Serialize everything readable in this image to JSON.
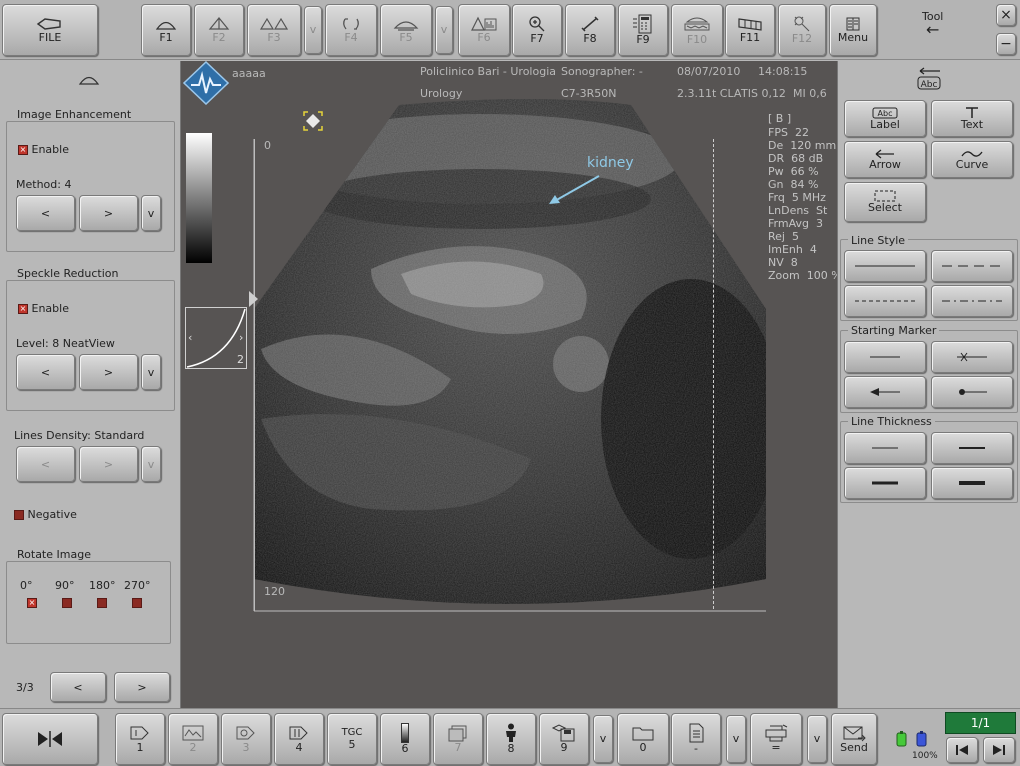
{
  "top_toolbar": {
    "file_label": "FILE",
    "keys": [
      {
        "label": "F1",
        "icon": "probe-icon"
      },
      {
        "label": "F2",
        "icon": "probe-icon"
      },
      {
        "label": "F3",
        "icon": "probe-pair-icon"
      },
      {
        "label": "v",
        "icon": ""
      },
      {
        "label": "F4",
        "icon": "rotate-icon"
      },
      {
        "label": "F5",
        "icon": "probe-icon"
      },
      {
        "label": "v",
        "icon": ""
      },
      {
        "label": "F6",
        "icon": "sector-icon"
      },
      {
        "label": "F7",
        "icon": "zoom-icon"
      },
      {
        "label": "F8",
        "icon": "measure-icon"
      },
      {
        "label": "F9",
        "icon": "calculator-icon"
      },
      {
        "label": "F10",
        "icon": "scan-icon"
      },
      {
        "label": "F11",
        "icon": "film-icon"
      },
      {
        "label": "F12",
        "icon": "spark-icon"
      },
      {
        "label": "Menu",
        "icon": "menu-icon"
      }
    ],
    "tool_label": "Tool",
    "tool_arrow": "←",
    "close_label": "×",
    "minimize_label": "−"
  },
  "left_panel": {
    "image_enhancement": {
      "title": "Image Enhancement",
      "enable_label": "Enable",
      "method_label": "Method: 4",
      "prev": "<",
      "next": ">",
      "dropdown": "v"
    },
    "speckle_reduction": {
      "title": "Speckle Reduction",
      "enable_label": "Enable",
      "level_label": "Level: 8 NeatView",
      "prev": "<",
      "next": ">",
      "dropdown": "v"
    },
    "lines_density": {
      "label": "Lines Density: Standard",
      "prev": "<",
      "next": ">",
      "dropdown": "v"
    },
    "negative_label": "Negative",
    "rotate_image": {
      "title": "Rotate Image",
      "options": [
        "0°",
        "90°",
        "180°",
        "270°"
      ]
    },
    "page_label": "3/3",
    "page_prev": "<",
    "page_next": ">"
  },
  "image_header": {
    "patient": "aaaaa",
    "hospital": "Policlinico Bari - Urologia",
    "sonographer": "Sonographer: -",
    "date": "08/07/2010",
    "time": "14:08:15",
    "department": "Urology",
    "probe": "C7-3R50N",
    "version": "2.3.11t CLA",
    "tis": "TIS 0,12",
    "mi": "MI 0,6"
  },
  "image_params": {
    "mode": "[ B ]",
    "rows": [
      [
        "FPS",
        "22"
      ],
      [
        "De",
        "120 mm"
      ],
      [
        "DR",
        "68 dB"
      ],
      [
        "Pw",
        "66 %"
      ],
      [
        "Gn",
        "84 %"
      ],
      [
        "Frq",
        "5 MHz"
      ],
      [
        "LnDens",
        "St"
      ],
      [
        "FrmAvg",
        "3"
      ],
      [
        "Rej",
        "5"
      ],
      [
        "ImEnh",
        "4"
      ],
      [
        "NV",
        "8"
      ],
      [
        "Zoom",
        "100 %"
      ]
    ]
  },
  "image": {
    "annotation": "kidney",
    "depth_top": "0",
    "depth_bottom": "120",
    "curve_label": "2"
  },
  "right_panel": {
    "annotation_buttons": [
      {
        "label": "Label",
        "icon": "abc-label-icon"
      },
      {
        "label": "Text",
        "icon": "text-icon"
      },
      {
        "label": "Arrow",
        "icon": "arrow-icon"
      },
      {
        "label": "Curve",
        "icon": "curve-icon"
      },
      {
        "label": "Select",
        "icon": "select-icon"
      }
    ],
    "line_style_title": "Line Style",
    "starting_marker_title": "Starting Marker",
    "line_thickness_title": "Line Thickness"
  },
  "bottom_toolbar": {
    "keys": [
      {
        "label": "1",
        "icon": "probe-1-icon"
      },
      {
        "label": "2",
        "icon": "image-2-icon"
      },
      {
        "label": "3",
        "icon": "probe-3-icon"
      },
      {
        "label": "4",
        "icon": "probe-4-icon"
      },
      {
        "label": "5",
        "icon": "tgc-icon",
        "text": "TGC"
      },
      {
        "label": "6",
        "icon": "grayscale-icon"
      },
      {
        "label": "7",
        "icon": "pages-icon"
      },
      {
        "label": "8",
        "icon": "person-icon"
      },
      {
        "label": "9",
        "icon": "save-icon"
      },
      {
        "label": "v",
        "icon": ""
      },
      {
        "label": "0",
        "icon": "folder-icon"
      },
      {
        "label": "-",
        "icon": "document-icon"
      },
      {
        "label": "v",
        "icon": ""
      },
      {
        "label": "=",
        "icon": "print-icon"
      },
      {
        "label": "v",
        "icon": ""
      },
      {
        "label": "Send",
        "icon": "send-icon"
      }
    ],
    "battery_label": "100%",
    "page_counter": "1/1"
  },
  "colors": {
    "image_bg": "#575453",
    "panel_bg": "#b8b8b8",
    "annotation_color": "#8fc9e6",
    "checkbox_red": "#c0362c",
    "page_counter_bg": "#1f7a3a"
  }
}
